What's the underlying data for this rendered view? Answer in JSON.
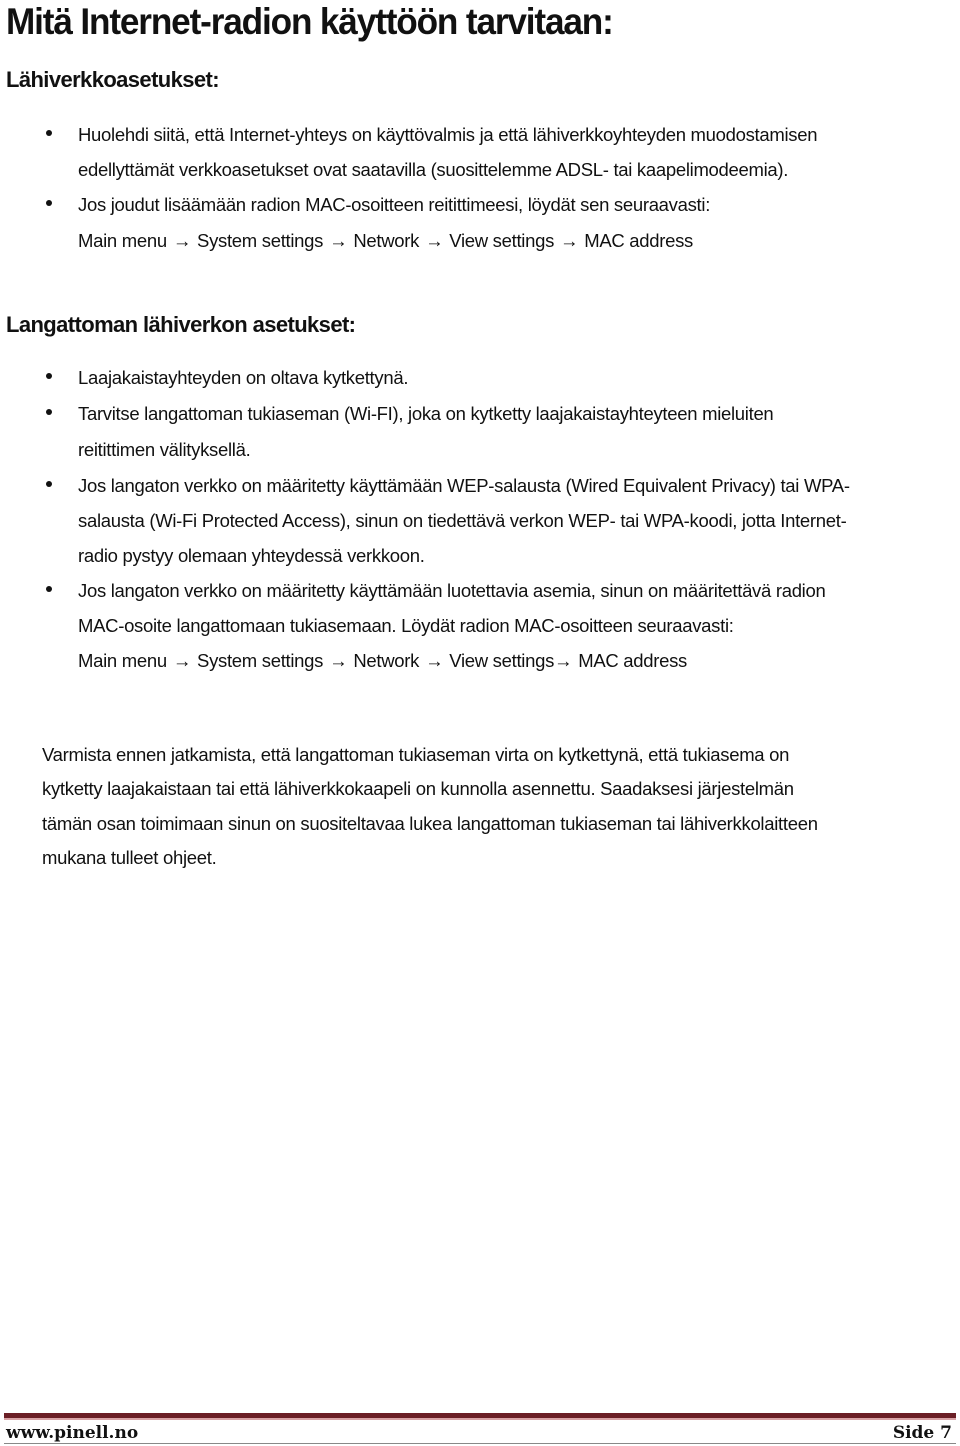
{
  "document": {
    "title": "Mitä Internet-radion käyttöön tarvitaan:",
    "section1": {
      "heading": "Lähiverkkoasetukset:",
      "bullet1": {
        "line1": "Huolehdi siitä, että Internet-yhteys on käyttövalmis ja että lähiverkkoyhteyden muodostamisen",
        "line2": "edellyttämät verkkoasetukset ovat saatavilla (suosittelemme ADSL- tai kaapelimodeemia)."
      },
      "bullet2": {
        "line1": "Jos joudut lisäämään radion MAC-osoitteen reitittimeesi, löydät sen seuraavasti:",
        "path": [
          "Main menu",
          "System settings",
          "Network",
          "View settings",
          "MAC address"
        ]
      }
    },
    "section2": {
      "heading": "Langattoman lähiverkon asetukset:",
      "bullet1": {
        "line1": "Laajakaistayhteyden on oltava kytkettynä."
      },
      "bullet2": {
        "line1": "Tarvitse langattoman tukiaseman (Wi-FI), joka on kytketty laajakaistayhteyteen mieluiten",
        "line2": "reitittimen välityksellä."
      },
      "bullet3": {
        "line1": "Jos langaton verkko on määritetty käyttämään WEP-salausta (Wired Equivalent Privacy) tai WPA-",
        "line2": "salausta (Wi-Fi Protected Access), sinun on tiedettävä verkon WEP- tai WPA-koodi, jotta Internet-",
        "line3": "radio pystyy olemaan yhteydessä verkkoon."
      },
      "bullet4": {
        "line1": "Jos langaton verkko on määritetty käyttämään luotettavia asemia, sinun on määritettävä radion",
        "line2": "MAC-osoite langattomaan tukiasemaan. Löydät radion MAC-osoitteen seuraavasti:",
        "path": [
          "Main menu",
          "System settings",
          "Network",
          "View settings",
          "MAC address"
        ]
      }
    },
    "paragraph": {
      "line1": "Varmista ennen jatkamista, että langattoman tukiaseman virta on kytkettynä, että tukiasema on",
      "line2": "kytketty laajakaistaan tai että lähiverkkokaapeli on kunnolla asennettu. Saadaksesi järjestelmän",
      "line3": "tämän osan toimimaan sinun on suositeltavaa lukea langattoman tukiaseman tai lähiverkkolaitteen",
      "line4": "mukana tulleet ohjeet."
    },
    "arrow_glyph": "→"
  },
  "footer": {
    "website": "www.pinell.no",
    "page_label": "Side 7",
    "colors": {
      "dark_bar": "#6b1f26",
      "light_bar": "#d9a3a6",
      "underline": "#888888"
    }
  }
}
